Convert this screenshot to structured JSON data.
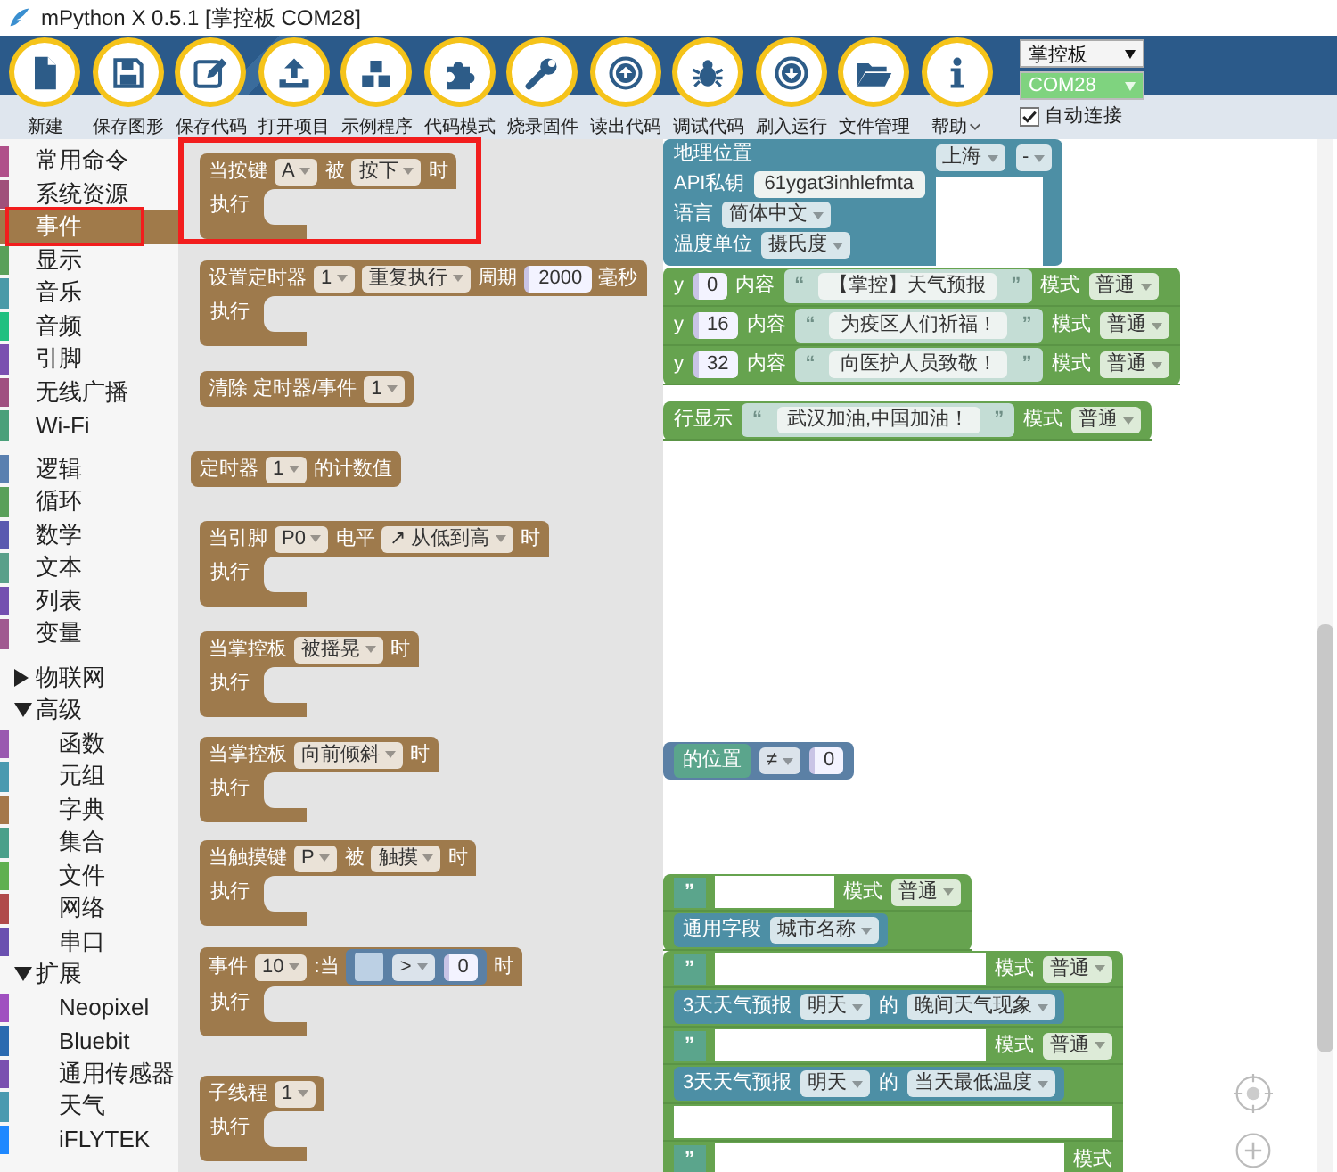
{
  "window": {
    "title": "mPython X 0.5.1 [掌控板 COM28]"
  },
  "toolbar": {
    "buttons": [
      {
        "label": "新建",
        "has_menu": false
      },
      {
        "label": "保存图形",
        "has_menu": false
      },
      {
        "label": "保存代码",
        "has_menu": false
      },
      {
        "label": "打开项目",
        "has_menu": false
      },
      {
        "label": "示例程序",
        "has_menu": false
      },
      {
        "label": "代码模式",
        "has_menu": false
      },
      {
        "label": "烧录固件",
        "has_menu": false
      },
      {
        "label": "读出代码",
        "has_menu": false
      },
      {
        "label": "调试代码",
        "has_menu": false
      },
      {
        "label": "刷入运行",
        "has_menu": false
      },
      {
        "label": "文件管理",
        "has_menu": false
      },
      {
        "label": "帮助",
        "has_menu": true
      }
    ],
    "board_select": {
      "value": "掌控板"
    },
    "port_select": {
      "value": "COM28",
      "connected": true
    },
    "auto_connect": {
      "label": "自动连接",
      "checked": true
    }
  },
  "sidebar": {
    "sections": [
      {
        "items": [
          {
            "label": "常用命令",
            "color": "#b0508a",
            "selected": false
          },
          {
            "label": "系统资源",
            "color": "#a0507a",
            "selected": false
          },
          {
            "label": "事件",
            "color": "#a07a4a",
            "selected": true
          },
          {
            "label": "显示",
            "color": "#5aa05a",
            "selected": false
          },
          {
            "label": "音乐",
            "color": "#4a9aa8",
            "selected": false
          },
          {
            "label": "音频",
            "color": "#20c080",
            "selected": false
          },
          {
            "label": "引脚",
            "color": "#7a50b0",
            "selected": false
          },
          {
            "label": "无线广播",
            "color": "#a04f80",
            "selected": false
          },
          {
            "label": "Wi-Fi",
            "color": "#4aa07a",
            "selected": false
          }
        ]
      },
      {
        "items": [
          {
            "label": "逻辑",
            "color": "#5a80b0",
            "selected": false
          },
          {
            "label": "循环",
            "color": "#5aa05a",
            "selected": false
          },
          {
            "label": "数学",
            "color": "#5a5ab0",
            "selected": false
          },
          {
            "label": "文本",
            "color": "#5aa08a",
            "selected": false
          },
          {
            "label": "列表",
            "color": "#7450b0",
            "selected": false
          },
          {
            "label": "变量",
            "color": "#a05a90",
            "selected": false
          }
        ]
      },
      {
        "items": [
          {
            "label": "物联网",
            "expanded": false,
            "selected": false
          },
          {
            "label": "高级",
            "expanded": true,
            "selected": false,
            "children": [
              {
                "label": "函数",
                "color": "#9a5ab0",
                "selected": false
              },
              {
                "label": "元组",
                "color": "#4a9ab0",
                "selected": false
              },
              {
                "label": "字典",
                "color": "#a5784a",
                "selected": false
              },
              {
                "label": "集合",
                "color": "#4aa08a",
                "selected": false
              },
              {
                "label": "文件",
                "color": "#60b050",
                "selected": false
              },
              {
                "label": "网络",
                "color": "#b04a4a",
                "selected": false
              },
              {
                "label": "串口",
                "color": "#6a50b0",
                "selected": false
              }
            ]
          },
          {
            "label": "扩展",
            "expanded": true,
            "selected": false,
            "children": [
              {
                "label": "Neopixel",
                "color": "#a050c0",
                "selected": false
              },
              {
                "label": "Bluebit",
                "color": "#2a6ab0",
                "selected": false
              },
              {
                "label": "通用传感器",
                "color": "#7a50b0",
                "selected": false
              },
              {
                "label": "天气",
                "color": "#4a9ab0",
                "selected": false
              },
              {
                "label": "iFLYTEK",
                "color": "#1e88ff",
                "selected": false
              }
            ]
          }
        ]
      }
    ]
  },
  "flyout": {
    "blocks": [
      {
        "kind": "event",
        "rows": [
          [
            {
              "kind": "label",
              "text": "当按键"
            },
            {
              "kind": "dropdown",
              "text": "A"
            },
            {
              "kind": "label",
              "text": "被"
            },
            {
              "kind": "dropdown",
              "text": "按下"
            },
            {
              "kind": "label",
              "text": "时"
            }
          ]
        ],
        "statement_label": "执行"
      },
      {
        "kind": "event",
        "rows": [
          [
            {
              "kind": "label",
              "text": "设置定时器"
            },
            {
              "kind": "dropdown",
              "text": "1"
            },
            {
              "kind": "dropdown",
              "text": "重复执行"
            },
            {
              "kind": "label",
              "text": "周期"
            },
            {
              "kind": "number",
              "text": "2000"
            },
            {
              "kind": "label",
              "text": "毫秒"
            }
          ]
        ],
        "statement_label": "执行"
      },
      {
        "kind": "event",
        "rows": [
          [
            {
              "kind": "label",
              "text": "清除 定时器/事件"
            },
            {
              "kind": "dropdown",
              "text": "1"
            }
          ]
        ]
      },
      {
        "kind": "event",
        "rows": [
          [
            {
              "kind": "label",
              "text": "定时器"
            },
            {
              "kind": "dropdown",
              "text": "1"
            },
            {
              "kind": "label",
              "text": "的计数值"
            }
          ]
        ]
      },
      {
        "kind": "event",
        "rows": [
          [
            {
              "kind": "label",
              "text": "当引脚"
            },
            {
              "kind": "dropdown",
              "text": "P0"
            },
            {
              "kind": "label",
              "text": "电平"
            },
            {
              "kind": "dropdown",
              "text": "↗ 从低到高"
            },
            {
              "kind": "label",
              "text": "时"
            }
          ]
        ],
        "statement_label": "执行"
      },
      {
        "kind": "event",
        "rows": [
          [
            {
              "kind": "label",
              "text": "当掌控板"
            },
            {
              "kind": "dropdown",
              "text": "被摇晃"
            },
            {
              "kind": "label",
              "text": "时"
            }
          ]
        ],
        "statement_label": "执行"
      },
      {
        "kind": "event",
        "rows": [
          [
            {
              "kind": "label",
              "text": "当掌控板"
            },
            {
              "kind": "dropdown",
              "text": "向前倾斜"
            },
            {
              "kind": "label",
              "text": "时"
            }
          ]
        ],
        "statement_label": "执行"
      },
      {
        "kind": "event",
        "rows": [
          [
            {
              "kind": "label",
              "text": "当触摸键"
            },
            {
              "kind": "dropdown",
              "text": "P"
            },
            {
              "kind": "label",
              "text": "被"
            },
            {
              "kind": "dropdown",
              "text": "触摸"
            },
            {
              "kind": "label",
              "text": "时"
            }
          ]
        ],
        "statement_label": "执行"
      },
      {
        "kind": "event",
        "rows": [
          [
            {
              "kind": "label",
              "text": "事件"
            },
            {
              "kind": "dropdown",
              "text": "10"
            },
            {
              "kind": "label",
              "text": ":当"
            },
            {
              "kind": "logic_block",
              "tokens": [
                {
                  "kind": "socket"
                },
                {
                  "kind": "dropdown",
                  "text": ">"
                },
                {
                  "kind": "number",
                  "text": "0"
                }
              ]
            },
            {
              "kind": "label",
              "text": "时"
            }
          ]
        ],
        "statement_label": "执行"
      },
      {
        "kind": "event",
        "rows": [
          [
            {
              "kind": "label",
              "text": "子线程"
            },
            {
              "kind": "dropdown",
              "text": "1"
            }
          ]
        ],
        "statement_label": "执行"
      }
    ]
  },
  "workspace": {
    "blocks": [
      {
        "kind": "weather",
        "rows": [
          [
            {
              "kind": "label",
              "text": "地理位置"
            }
          ],
          [
            {
              "kind": "label",
              "text": "API私钥"
            },
            {
              "kind": "field",
              "text": "61ygat3inhlefmta"
            }
          ],
          [
            {
              "kind": "label",
              "text": "语言"
            },
            {
              "kind": "dropdown",
              "text": "简体中文"
            }
          ],
          [
            {
              "kind": "label",
              "text": "温度单位"
            },
            {
              "kind": "dropdown",
              "text": "摄氏度"
            }
          ]
        ],
        "aside": [
          {
            "kind": "dropdown",
            "text": "上海"
          },
          {
            "kind": "dropdown",
            "text": "-"
          }
        ]
      },
      {
        "kind": "display",
        "rows": [
          [
            {
              "kind": "label",
              "text": "y"
            },
            {
              "kind": "number",
              "text": "0"
            },
            {
              "kind": "label",
              "text": "内容"
            },
            {
              "kind": "string",
              "quotes": [
                "“",
                "”"
              ],
              "text": "【掌控】天气预报"
            },
            {
              "kind": "label",
              "text": "模式"
            },
            {
              "kind": "dropdown",
              "text": "普通"
            }
          ],
          [
            {
              "kind": "label",
              "text": "y"
            },
            {
              "kind": "number",
              "text": "16"
            },
            {
              "kind": "label",
              "text": "内容"
            },
            {
              "kind": "string",
              "quotes": [
                "“",
                "”"
              ],
              "text": "为疫区人们祈福！"
            },
            {
              "kind": "label",
              "text": "模式"
            },
            {
              "kind": "dropdown",
              "text": "普通"
            }
          ],
          [
            {
              "kind": "label",
              "text": "y"
            },
            {
              "kind": "number",
              "text": "32"
            },
            {
              "kind": "label",
              "text": "内容"
            },
            {
              "kind": "string",
              "quotes": [
                "“",
                "”"
              ],
              "text": "向医护人员致敬！"
            },
            {
              "kind": "label",
              "text": "模式"
            },
            {
              "kind": "dropdown",
              "text": "普通"
            }
          ]
        ]
      },
      {
        "kind": "display",
        "rows": [
          [
            {
              "kind": "label",
              "text": "行显示"
            },
            {
              "kind": "string",
              "quotes": [
                "“",
                "”"
              ],
              "text": "武汉加油,中国加油！"
            },
            {
              "kind": "label",
              "text": "模式"
            },
            {
              "kind": "dropdown",
              "text": "普通"
            }
          ]
        ]
      },
      {
        "kind": "logic",
        "rows": [
          [
            {
              "kind": "text_block",
              "tokens": [
                {
                  "kind": "label",
                  "text": "的位置"
                }
              ]
            },
            {
              "kind": "dropdown",
              "text": "≠"
            },
            {
              "kind": "number",
              "text": "0"
            }
          ]
        ]
      },
      {
        "kind": "display",
        "rows": [
          [
            {
              "kind": "quote",
              "text": "”"
            },
            {
              "kind": "blank"
            },
            {
              "kind": "label",
              "text": "模式"
            },
            {
              "kind": "dropdown",
              "text": "普通"
            }
          ],
          [
            {
              "kind": "weather_block",
              "tokens": [
                {
                  "kind": "label",
                  "text": "通用字段"
                },
                {
                  "kind": "dropdown",
                  "text": "城市名称"
                }
              ]
            }
          ]
        ]
      },
      {
        "kind": "display",
        "rows": [
          [
            {
              "kind": "quote",
              "text": "”"
            },
            {
              "kind": "blank"
            },
            {
              "kind": "label",
              "text": "模式"
            },
            {
              "kind": "dropdown",
              "text": "普通"
            }
          ],
          [
            {
              "kind": "weather_block",
              "tokens": [
                {
                  "kind": "label",
                  "text": "3天天气预报"
                },
                {
                  "kind": "dropdown",
                  "text": "明天"
                },
                {
                  "kind": "label",
                  "text": "的"
                },
                {
                  "kind": "dropdown",
                  "text": "晚间天气现象"
                }
              ]
            }
          ],
          [
            {
              "kind": "quote",
              "text": "”"
            },
            {
              "kind": "blank"
            },
            {
              "kind": "label",
              "text": "模式"
            },
            {
              "kind": "dropdown",
              "text": "普通"
            }
          ],
          [
            {
              "kind": "weather_block",
              "tokens": [
                {
                  "kind": "label",
                  "text": "3天天气预报"
                },
                {
                  "kind": "dropdown",
                  "text": "明天"
                },
                {
                  "kind": "label",
                  "text": "的"
                },
                {
                  "kind": "dropdown",
                  "text": "当天最低温度"
                }
              ]
            }
          ],
          [
            {
              "kind": "blank"
            }
          ],
          [
            {
              "kind": "quote",
              "text": "”"
            },
            {
              "kind": "blank"
            },
            {
              "kind": "label",
              "text": "模式"
            }
          ]
        ]
      }
    ]
  }
}
